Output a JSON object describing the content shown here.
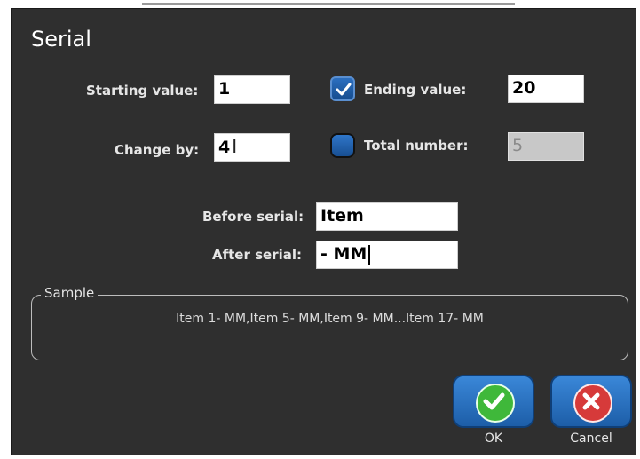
{
  "dialog": {
    "title": "Serial"
  },
  "fields": {
    "starting_value": {
      "label": "Starting value:",
      "value": "1"
    },
    "ending_value": {
      "label": "Ending value:",
      "value": "20",
      "checked": true
    },
    "change_by": {
      "label": "Change by:",
      "value": "4"
    },
    "total_number": {
      "label": "Total number:",
      "value": "5",
      "selected": false
    },
    "before_serial": {
      "label": "Before serial:",
      "value": "Item"
    },
    "after_serial": {
      "label": "After serial:",
      "value": "- MM"
    }
  },
  "sample": {
    "legend": "Sample",
    "text": "Item 1- MM,Item 5- MM,Item 9- MM...Item 17- MM"
  },
  "buttons": {
    "ok_label": "OK",
    "cancel_label": "Cancel"
  },
  "colors": {
    "dialog_bg": "#2f2f2f",
    "accent_blue": "#2b6fc0",
    "ok_green": "#3fb83a",
    "cancel_red": "#d63a3a"
  },
  "icons": {
    "ok": "check-icon",
    "cancel": "x-icon",
    "checkbox": "checkmark-icon"
  }
}
